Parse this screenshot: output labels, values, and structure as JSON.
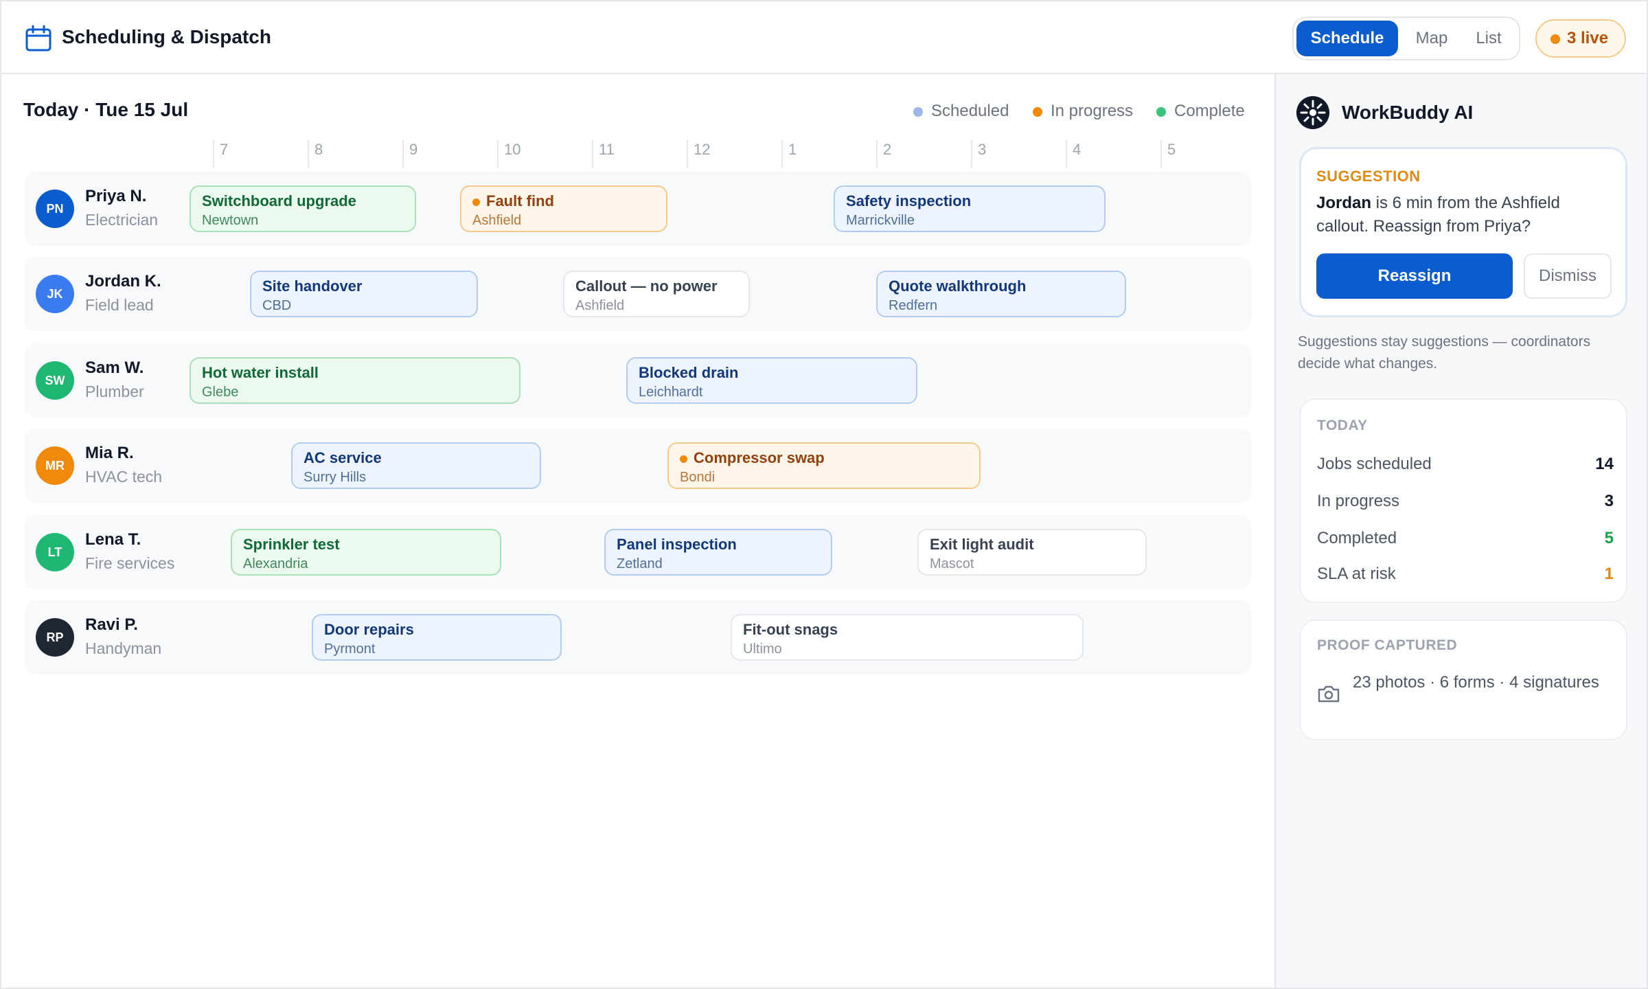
{
  "header": {
    "title": "Scheduling & Dispatch",
    "views": [
      "Schedule",
      "Map",
      "List"
    ],
    "active_view": "Schedule",
    "live_label": "3 live"
  },
  "board": {
    "date_title": "Today · Tue 15 Jul",
    "legend": {
      "scheduled": "Scheduled",
      "in_progress": "In progress",
      "complete": "Complete"
    },
    "hours": [
      "7",
      "8",
      "9",
      "10",
      "11",
      "12",
      "1",
      "2",
      "3",
      "4",
      "5"
    ],
    "rows": [
      {
        "initials": "PN",
        "name": "Priya N.",
        "role": "Electrician",
        "avatar_color": "#0b5ccf",
        "jobs": [
          {
            "title": "Switchboard upgrade",
            "suburb": "Newtown",
            "status": "complete"
          },
          {
            "title": "Fault find",
            "suburb": "Ashfield",
            "status": "progress"
          },
          {
            "title": "Safety inspection",
            "suburb": "Marrickville",
            "status": "scheduled"
          }
        ]
      },
      {
        "initials": "JK",
        "name": "Jordan K.",
        "role": "Field lead",
        "avatar_color": "#3a7bf0",
        "jobs": [
          {
            "title": "Site handover",
            "suburb": "CBD",
            "status": "scheduled"
          },
          {
            "title": "Callout — no power",
            "suburb": "Ashfield",
            "status": "neutral"
          },
          {
            "title": "Quote walkthrough",
            "suburb": "Redfern",
            "status": "scheduled"
          }
        ]
      },
      {
        "initials": "SW",
        "name": "Sam W.",
        "role": "Plumber",
        "avatar_color": "#1fb873",
        "jobs": [
          {
            "title": "Hot water install",
            "suburb": "Glebe",
            "status": "complete"
          },
          {
            "title": "Blocked drain",
            "suburb": "Leichhardt",
            "status": "scheduled"
          }
        ]
      },
      {
        "initials": "MR",
        "name": "Mia R.",
        "role": "HVAC tech",
        "avatar_color": "#f08a0c",
        "jobs": [
          {
            "title": "AC service",
            "suburb": "Surry Hills",
            "status": "scheduled"
          },
          {
            "title": "Compressor swap",
            "suburb": "Bondi",
            "status": "progress"
          }
        ]
      },
      {
        "initials": "LT",
        "name": "Lena T.",
        "role": "Fire services",
        "avatar_color": "#1fb873",
        "jobs": [
          {
            "title": "Sprinkler test",
            "suburb": "Alexandria",
            "status": "complete"
          },
          {
            "title": "Panel inspection",
            "suburb": "Zetland",
            "status": "scheduled"
          },
          {
            "title": "Exit light audit",
            "suburb": "Mascot",
            "status": "neutral"
          }
        ]
      },
      {
        "initials": "RP",
        "name": "Ravi P.",
        "role": "Handyman",
        "avatar_color": "#1f2733",
        "jobs": [
          {
            "title": "Door repairs",
            "suburb": "Pyrmont",
            "status": "scheduled"
          },
          {
            "title": "Fit-out snags",
            "suburb": "Ultimo",
            "status": "neutral"
          }
        ]
      }
    ]
  },
  "sidebar": {
    "title": "WorkBuddy AI",
    "suggestion": {
      "label": "SUGGESTION",
      "name": "Jordan",
      "text": " is 6 min from the Ashfield callout. Reassign from Priya?",
      "primary": "Reassign",
      "secondary": "Dismiss"
    },
    "note": "Suggestions stay suggestions — coordinators decide what changes.",
    "today": {
      "label": "TODAY",
      "stats": [
        {
          "label": "Jobs scheduled",
          "value": "14",
          "color": "#111827"
        },
        {
          "label": "In progress",
          "value": "3",
          "color": "#111827"
        },
        {
          "label": "Completed",
          "value": "5",
          "color": "#16a34a"
        },
        {
          "label": "SLA at risk",
          "value": "1",
          "color": "#e08a12"
        }
      ]
    },
    "proof": {
      "label": "PROOF CAPTURED",
      "text": "23 photos · 6 forms · 4 signatures"
    }
  }
}
